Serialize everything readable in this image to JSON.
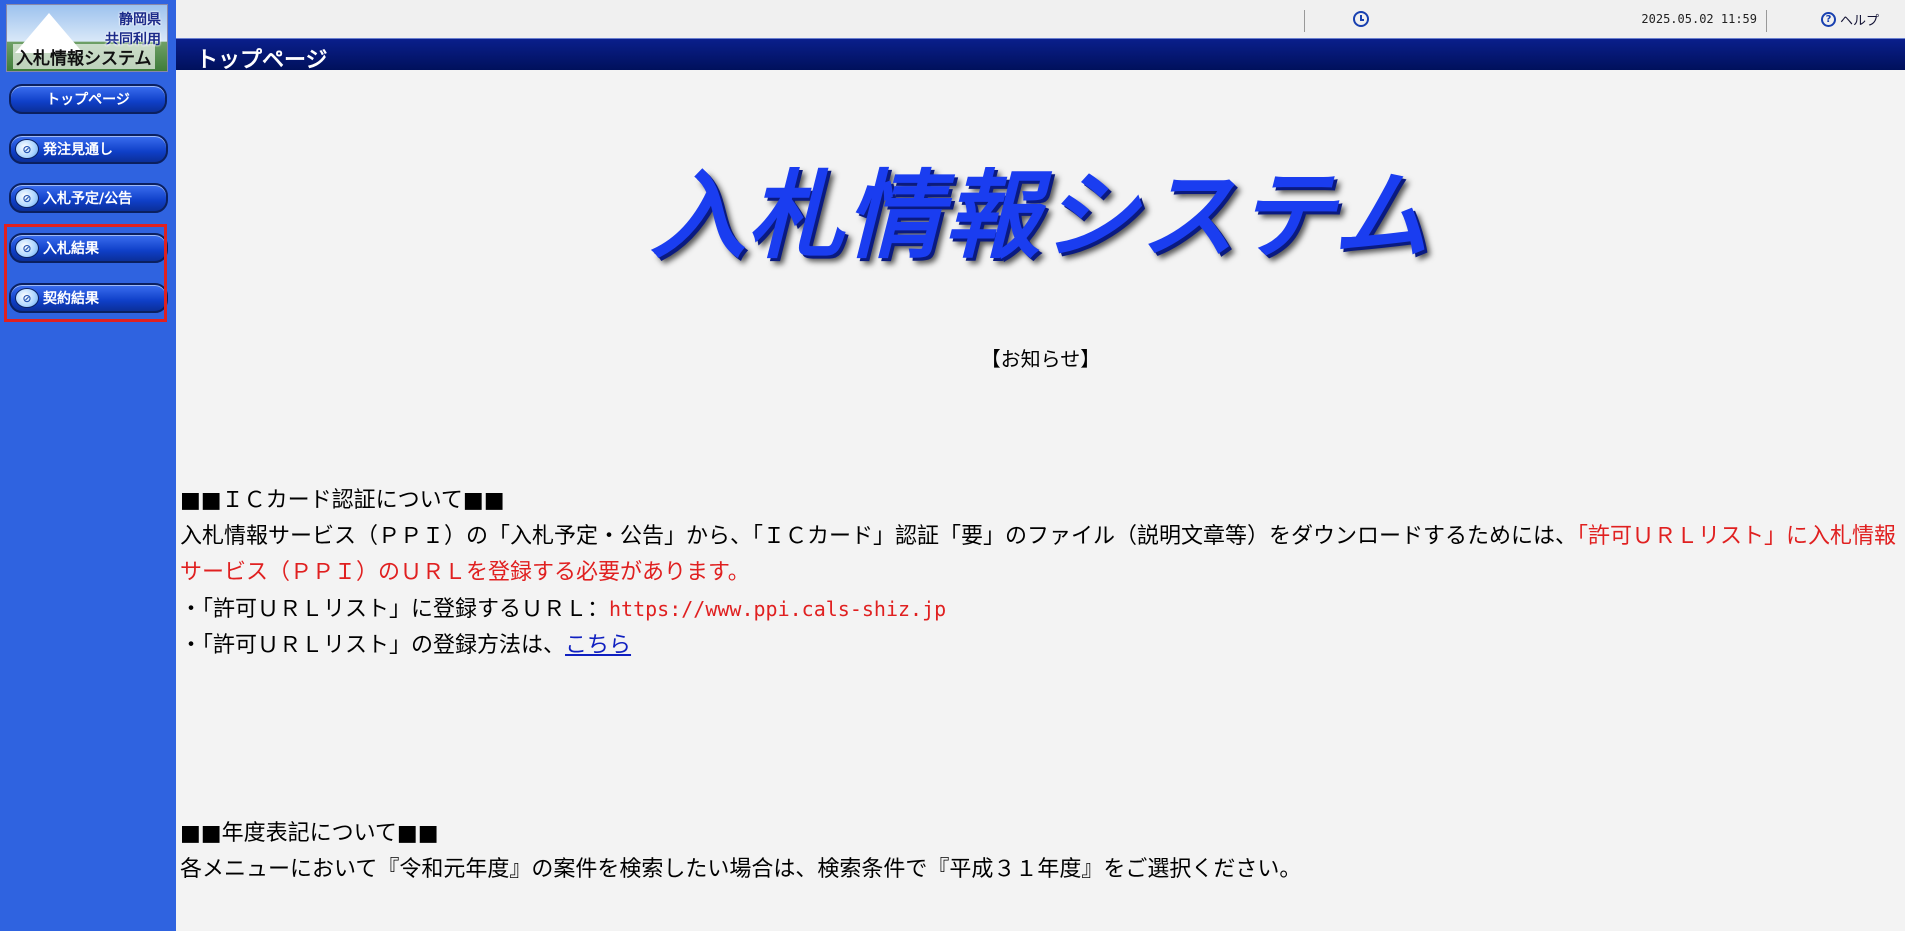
{
  "logo": {
    "line1": "静岡県",
    "line2": "共同利用",
    "line3": "入札情報システム"
  },
  "sidebar": {
    "top_button": "トップページ",
    "items": [
      {
        "label": "発注見通し"
      },
      {
        "label": "入札予定/公告"
      },
      {
        "label": "入札結果"
      },
      {
        "label": "契約結果"
      }
    ]
  },
  "header": {
    "datetime": "2025.05.02 11:59",
    "help_label": "ヘルプ"
  },
  "page_title": "トップページ",
  "main": {
    "big_title": "入札情報システム",
    "notice_heading": "【お知らせ】",
    "section1": {
      "heading": "■■ＩＣカード認証について■■",
      "text_black": "入札情報サービス（ＰＰＩ）の「入札予定・公告」から、「ＩＣカード」認証「要」のファイル（説明文章等）をダウンロードするためには、",
      "text_red": "「許可ＵＲＬリスト」に入札情報サービス（ＰＰＩ）のＵＲＬを登録する必要があります。",
      "bullet1_prefix": "・「許可ＵＲＬリスト」に登録するＵＲＬ：",
      "bullet1_url": "https://www.ppi.cals-shiz.jp",
      "bullet2_prefix": "・「許可ＵＲＬリスト」の登録方法は、",
      "bullet2_link": "こちら"
    },
    "section2": {
      "heading": "■■年度表記について■■",
      "text": "各メニューにおいて『令和元年度』の案件を検索したい場合は、検索条件で『平成３１年度』をご選択ください。"
    }
  },
  "colors": {
    "sidebar_bg": "#2f63e0",
    "title_bar": "#0a1f8c",
    "big_title": "#1a3df0",
    "highlight": "#e02020"
  }
}
